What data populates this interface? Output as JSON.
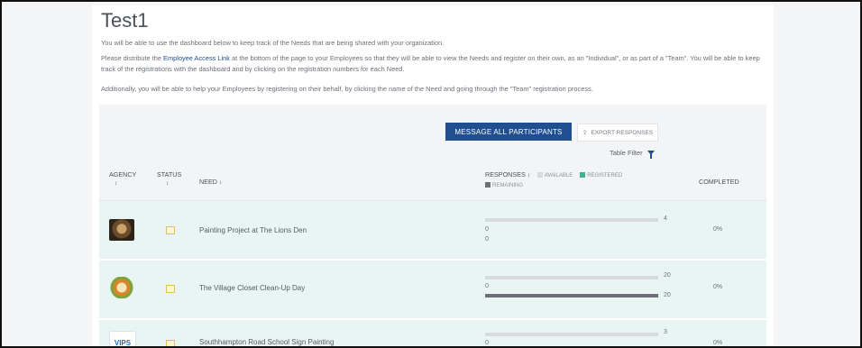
{
  "page": {
    "title": "Test1",
    "intro": "You will be able to use the dashboard below to keep track of the Needs that are being shared with your organization.",
    "para2_prefix": "Please distribute the ",
    "para2_link": "Employee Access Link",
    "para2_suffix": " at the bottom of the page to your Employees so that they will be able to view the Needs and register on their own, as an \"Individual\", or as part of a \"Team\". You will be able to keep track of the registrations with the dashboard and by clicking on the registration numbers for each Need.",
    "para3": "Additionally, you will be able to help your Employees by registering on their behalf, by clicking the name of the Need and going through the \"Team\" registration process."
  },
  "toolbar": {
    "message_label": "MESSAGE ALL PARTICIPANTS",
    "export_label": "EXPORT RESPONSES",
    "filter_label": "Table Filter"
  },
  "table": {
    "headers": {
      "agency": "AGENCY",
      "status": "STATUS",
      "need": "NEED",
      "responses": "RESPONSES",
      "completed": "COMPLETED",
      "sort_glyph": "↕"
    },
    "legend": {
      "available": "AVAILABLE",
      "registered": "REGISTERED",
      "remaining": "REMAINING"
    },
    "rows": [
      {
        "need": "Painting Project at The Lions Den",
        "available": "4",
        "registered": "0",
        "remaining": "0",
        "completed": "0%"
      },
      {
        "need": "The Village Closet Clean-Up Day",
        "available": "20",
        "registered": "0",
        "remaining": "20",
        "completed": "0%"
      },
      {
        "need": "Southhampton Road School Sign Painting",
        "available": "3",
        "registered": "0",
        "remaining": "",
        "completed": "0%"
      }
    ],
    "row3_logo_text": "VIPS"
  },
  "colors": {
    "primary": "#1f4f8f",
    "row_bg": "#e8f5f3",
    "registered": "#3db38a",
    "remaining": "#6c7178"
  }
}
